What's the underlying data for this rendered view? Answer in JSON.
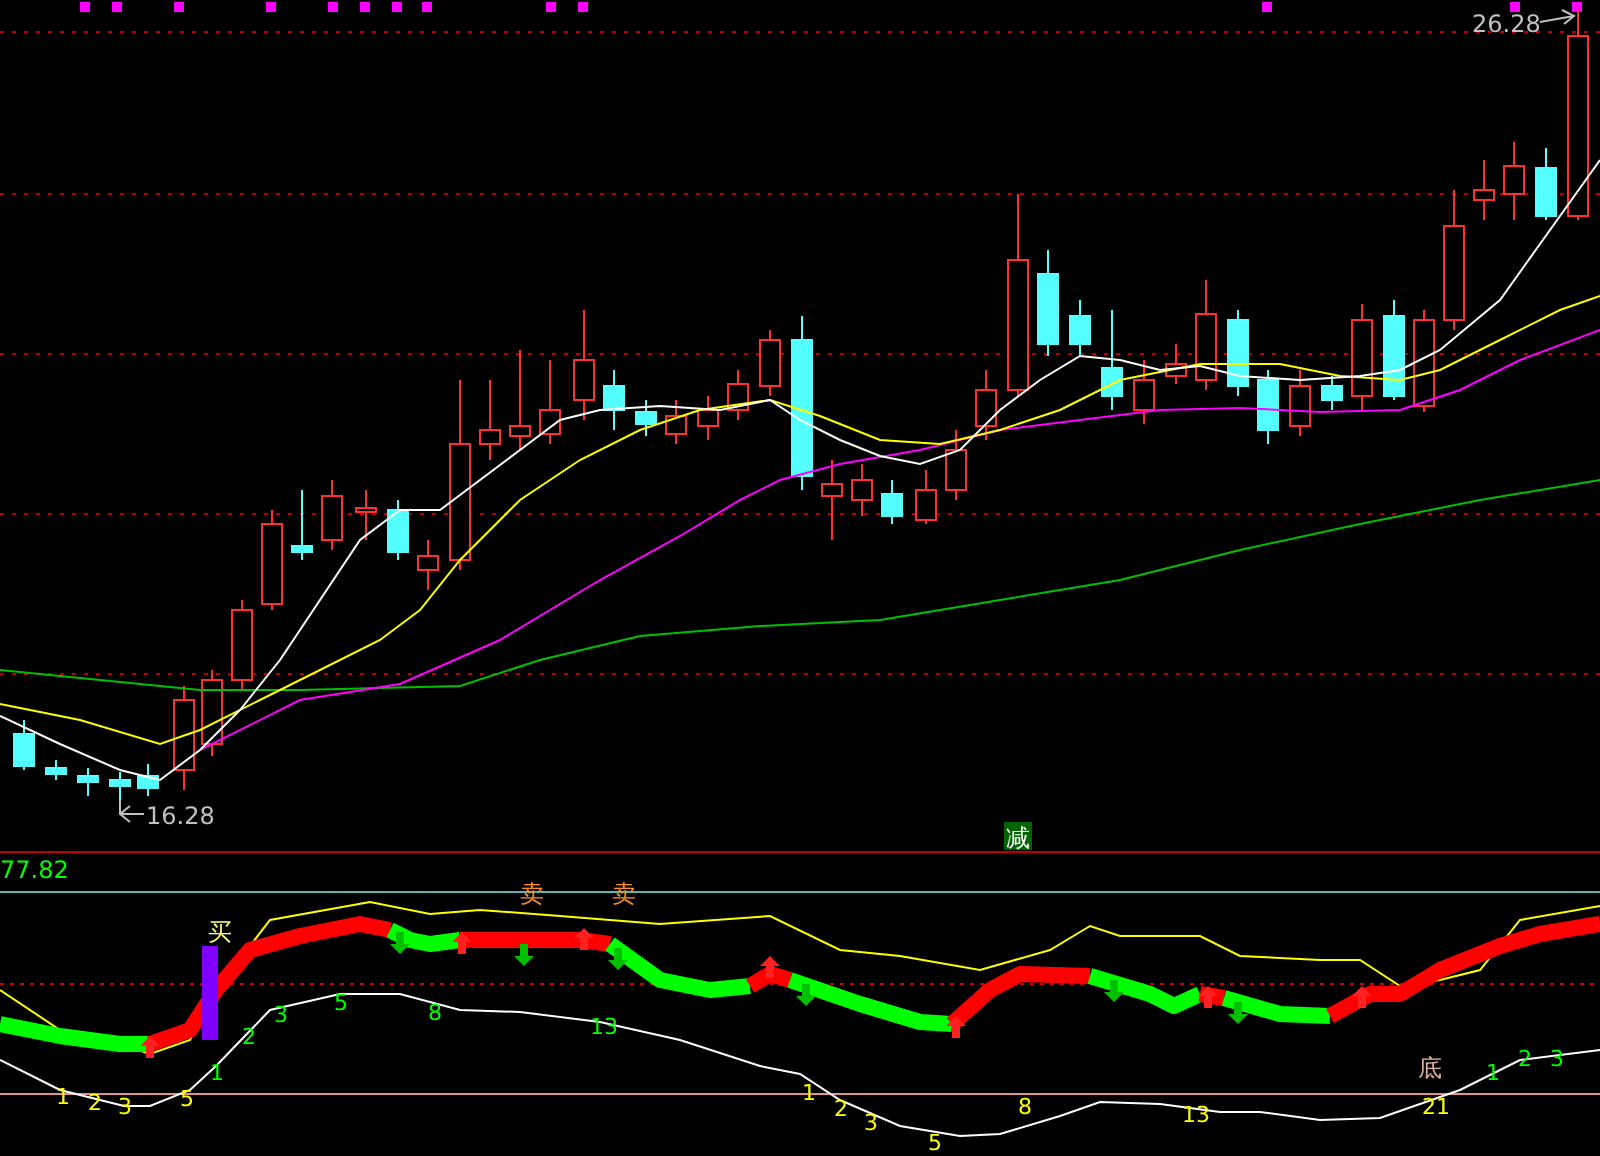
{
  "price_labels": {
    "high": "26.28",
    "low": "16.28"
  },
  "indicator": {
    "value": "77.82",
    "signal": "减",
    "buy": "买",
    "sell": [
      "卖",
      "卖"
    ],
    "bottom": "底",
    "counts": [
      {
        "text": "1",
        "color": "#ffff00"
      },
      {
        "text": "2",
        "color": "#ffff00"
      },
      {
        "text": "3",
        "color": "#ffff00"
      },
      {
        "text": "5",
        "color": "#ffff00"
      },
      {
        "text": "1",
        "color": "#00ff00"
      },
      {
        "text": "2",
        "color": "#00ff00"
      },
      {
        "text": "3",
        "color": "#00ff00"
      },
      {
        "text": "5",
        "color": "#00ff00"
      },
      {
        "text": "8",
        "color": "#00ff00"
      },
      {
        "text": "13",
        "color": "#00ff00"
      },
      {
        "text": "1",
        "color": "#ffff00"
      },
      {
        "text": "2",
        "color": "#ffff00"
      },
      {
        "text": "3",
        "color": "#ffff00"
      },
      {
        "text": "5",
        "color": "#ffff00"
      },
      {
        "text": "8",
        "color": "#ffff00"
      },
      {
        "text": "13",
        "color": "#ffff00"
      },
      {
        "text": "21",
        "color": "#ffff00"
      },
      {
        "text": "1",
        "color": "#00ff00"
      },
      {
        "text": "2",
        "color": "#00ff00"
      },
      {
        "text": "3",
        "color": "#00ff00"
      }
    ]
  }
}
